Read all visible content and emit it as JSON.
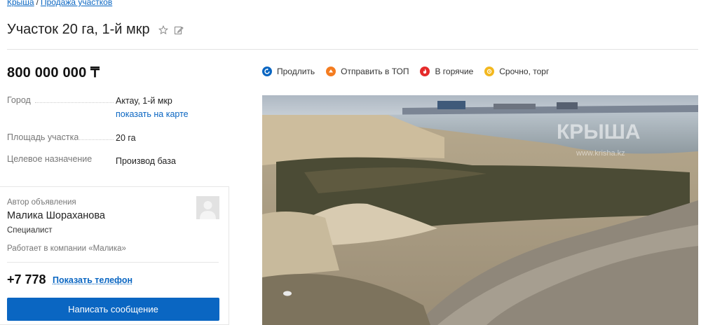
{
  "breadcrumb": {
    "home": "Крыша",
    "sep": "/",
    "section": "Продажа участков"
  },
  "title": "Участок 20 га, 1-й мкр",
  "price": "800 000 000 ₸",
  "params": [
    {
      "key": "Город",
      "value": "Актау, 1-й мкр",
      "link": "показать на карте"
    },
    {
      "key": "Площадь участка",
      "value": "20 га"
    },
    {
      "key": "Целевое назначение",
      "value": "Производ база"
    }
  ],
  "actions": [
    {
      "label": "Продлить",
      "color": "#0a66c2",
      "icon": "refresh-icon"
    },
    {
      "label": "Отправить в ТОП",
      "color": "#f47c20",
      "icon": "arrow-up-icon"
    },
    {
      "label": "В горячие",
      "color": "#e52b2b",
      "icon": "fire-icon"
    },
    {
      "label": "Срочно, торг",
      "color": "#f3b81f",
      "icon": "clock-icon"
    }
  ],
  "photo": {
    "watermark": "КРЫША",
    "watermark_sub": "www.krisha.kz"
  },
  "author": {
    "label": "Автор объявления",
    "name": "Малика Шораханова",
    "role": "Специалист",
    "company": "Работает в компании «Малика»",
    "phone": "+7 778",
    "show_phone": "Показать телефон",
    "message_button": "Написать сообщение"
  },
  "colors": {
    "accent": "#0a66c2"
  }
}
